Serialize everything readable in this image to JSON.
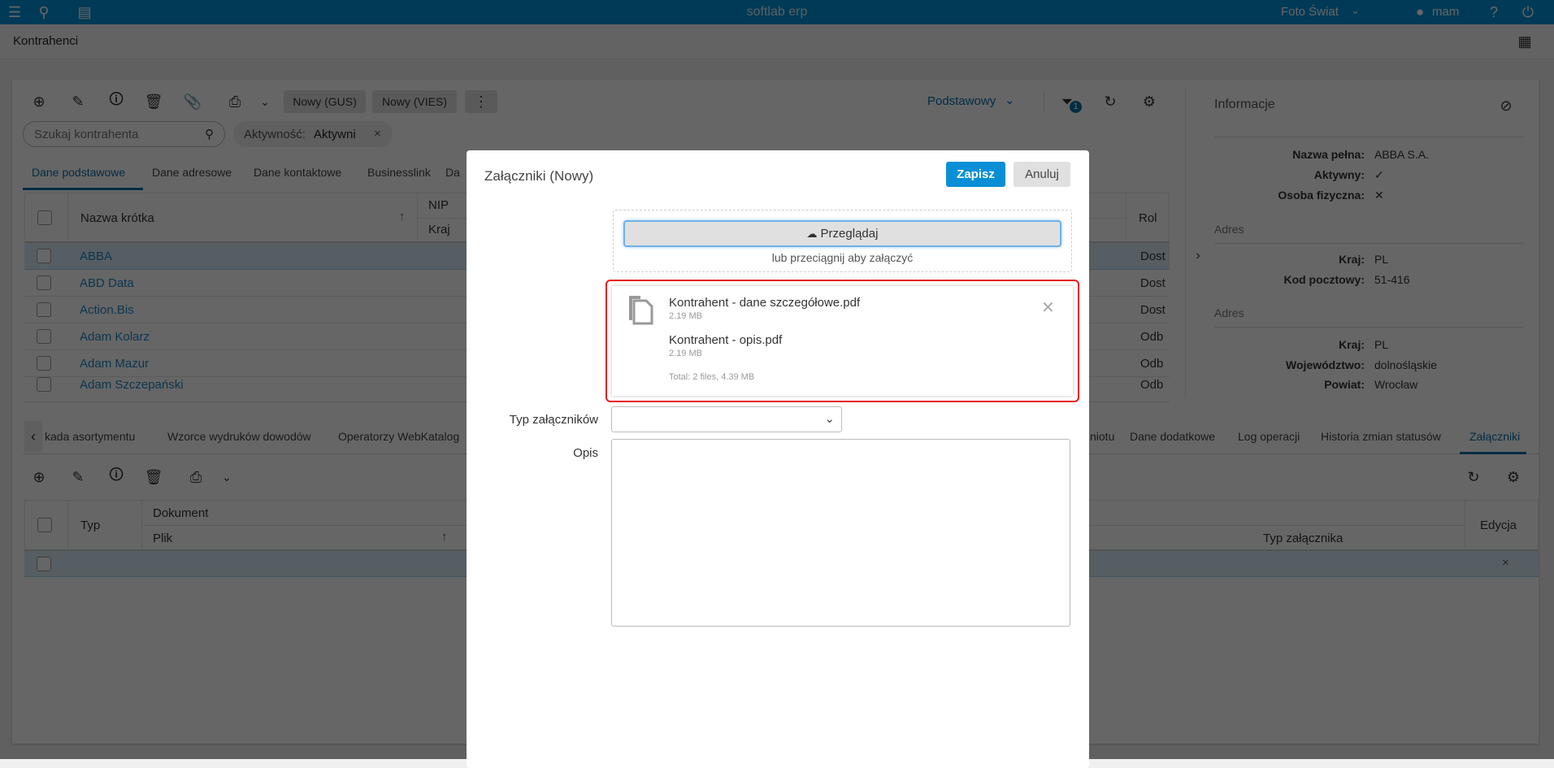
{
  "app": {
    "title": "softlab erp",
    "company": "Foto Świat",
    "user": "mam"
  },
  "page": {
    "title": "Kontrahenci"
  },
  "toolbar": {
    "nowy_gus": "Nowy (GUS)",
    "nowy_vies": "Nowy (VIES)",
    "view": "Podstawowy",
    "filter_count": "1"
  },
  "search": {
    "placeholder": "Szukaj kontrahenta",
    "value": ""
  },
  "filter_chip": {
    "label": "Aktywność:",
    "value": "Aktywni"
  },
  "tabs": [
    "Dane podstawowe",
    "Dane adresowe",
    "Dane kontaktowe",
    "Businesslink",
    "Da"
  ],
  "table": {
    "headers": {
      "name": "Nazwa krótka",
      "nip": "NIP",
      "kraj": "Kraj",
      "role": "Rol"
    },
    "rows": [
      {
        "name": "ABBA",
        "role": "Dost"
      },
      {
        "name": "ABD Data",
        "role": "Dost"
      },
      {
        "name": "Action.Bis",
        "role": "Dost"
      },
      {
        "name": "Adam Kolarz",
        "role": "Odb"
      },
      {
        "name": "Adam Mazur",
        "role": "Odb"
      },
      {
        "name": "Adam Szczepański",
        "role": "Odb"
      }
    ]
  },
  "info": {
    "title": "Informacje",
    "general": [
      {
        "label": "Nazwa pełna:",
        "value": "ABBA S.A."
      },
      {
        "label": "Aktywny:",
        "value": "✓"
      },
      {
        "label": "Osoba fizyczna:",
        "value": "✕"
      }
    ],
    "address1": {
      "title": "Adres",
      "fields": [
        {
          "label": "Kraj:",
          "value": "PL"
        },
        {
          "label": "Kod pocztowy:",
          "value": "51-416"
        }
      ]
    },
    "address2": {
      "title": "Adres",
      "fields": [
        {
          "label": "Kraj:",
          "value": "PL"
        },
        {
          "label": "Województwo:",
          "value": "dolnośląskie"
        },
        {
          "label": "Powiat:",
          "value": "Wrocław"
        }
      ]
    }
  },
  "bottom_tabs": {
    "left": [
      "kada asortymentu",
      "Wzorce wydruków dowodów",
      "Operatorzy WebKatalog"
    ],
    "right": [
      "niotu",
      "Dane dodatkowe",
      "Log operacji",
      "Historia zmian statusów",
      "Załączniki"
    ]
  },
  "bottom_table": {
    "headers": {
      "typ": "Typ",
      "dokument": "Dokument",
      "plik": "Plik",
      "typ_zal": "Typ załącznika",
      "edycja": "Edycja"
    }
  },
  "dialog": {
    "title": "Załączniki (Nowy)",
    "save": "Zapisz",
    "cancel": "Anuluj",
    "browse": "Przeglądaj",
    "drop_hint": "lub przeciągnij aby załączyć",
    "files": [
      {
        "name": "Kontrahent - dane szczegółowe.pdf",
        "size": "2.19 MB"
      },
      {
        "name": "Kontrahent - opis.pdf",
        "size": "2.19 MB"
      }
    ],
    "total": "Total: 2 files, 4.39 MB",
    "type_label": "Typ załączników",
    "type_value": "",
    "desc_label": "Opis",
    "desc_value": ""
  }
}
